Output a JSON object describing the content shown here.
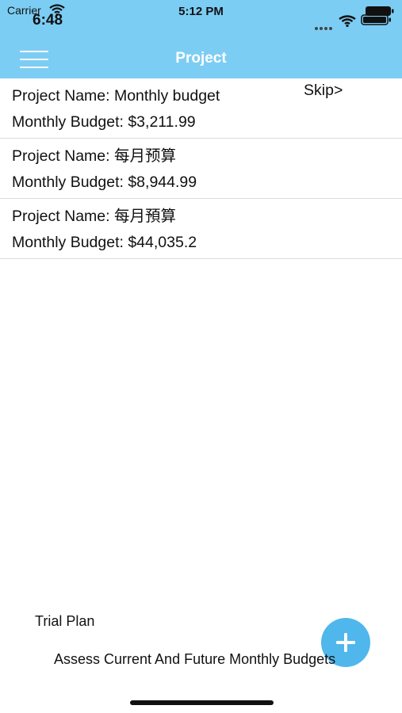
{
  "status_bar": {
    "carrier": "Carrier",
    "overlay_time": "6:48",
    "time": "5:12 PM"
  },
  "nav": {
    "title": "Project"
  },
  "skip": {
    "label": "Skip",
    "arrow": ">"
  },
  "projects": [
    {
      "name_line": "Project Name: Monthly budget",
      "budget_line": "Monthly Budget: $3,211.99"
    },
    {
      "name_line": "Project Name: 每月预算",
      "budget_line": "Monthly Budget: $8,944.99"
    },
    {
      "name_line": "Project Name: 每月預算",
      "budget_line": "Monthly Budget: $44,035.2"
    }
  ],
  "footer": {
    "trial_plan": "Trial Plan",
    "tagline": "Assess Current And Future Monthly Budgets"
  },
  "colors": {
    "header_bg": "#7ccdf4",
    "fab_bg": "#4fb7ec",
    "divider": "#dcdcdc"
  },
  "icons": {
    "menu": "hamburger-menu-icon",
    "add": "plus-icon",
    "wifi": "wifi-icon",
    "battery": "battery-icon"
  }
}
